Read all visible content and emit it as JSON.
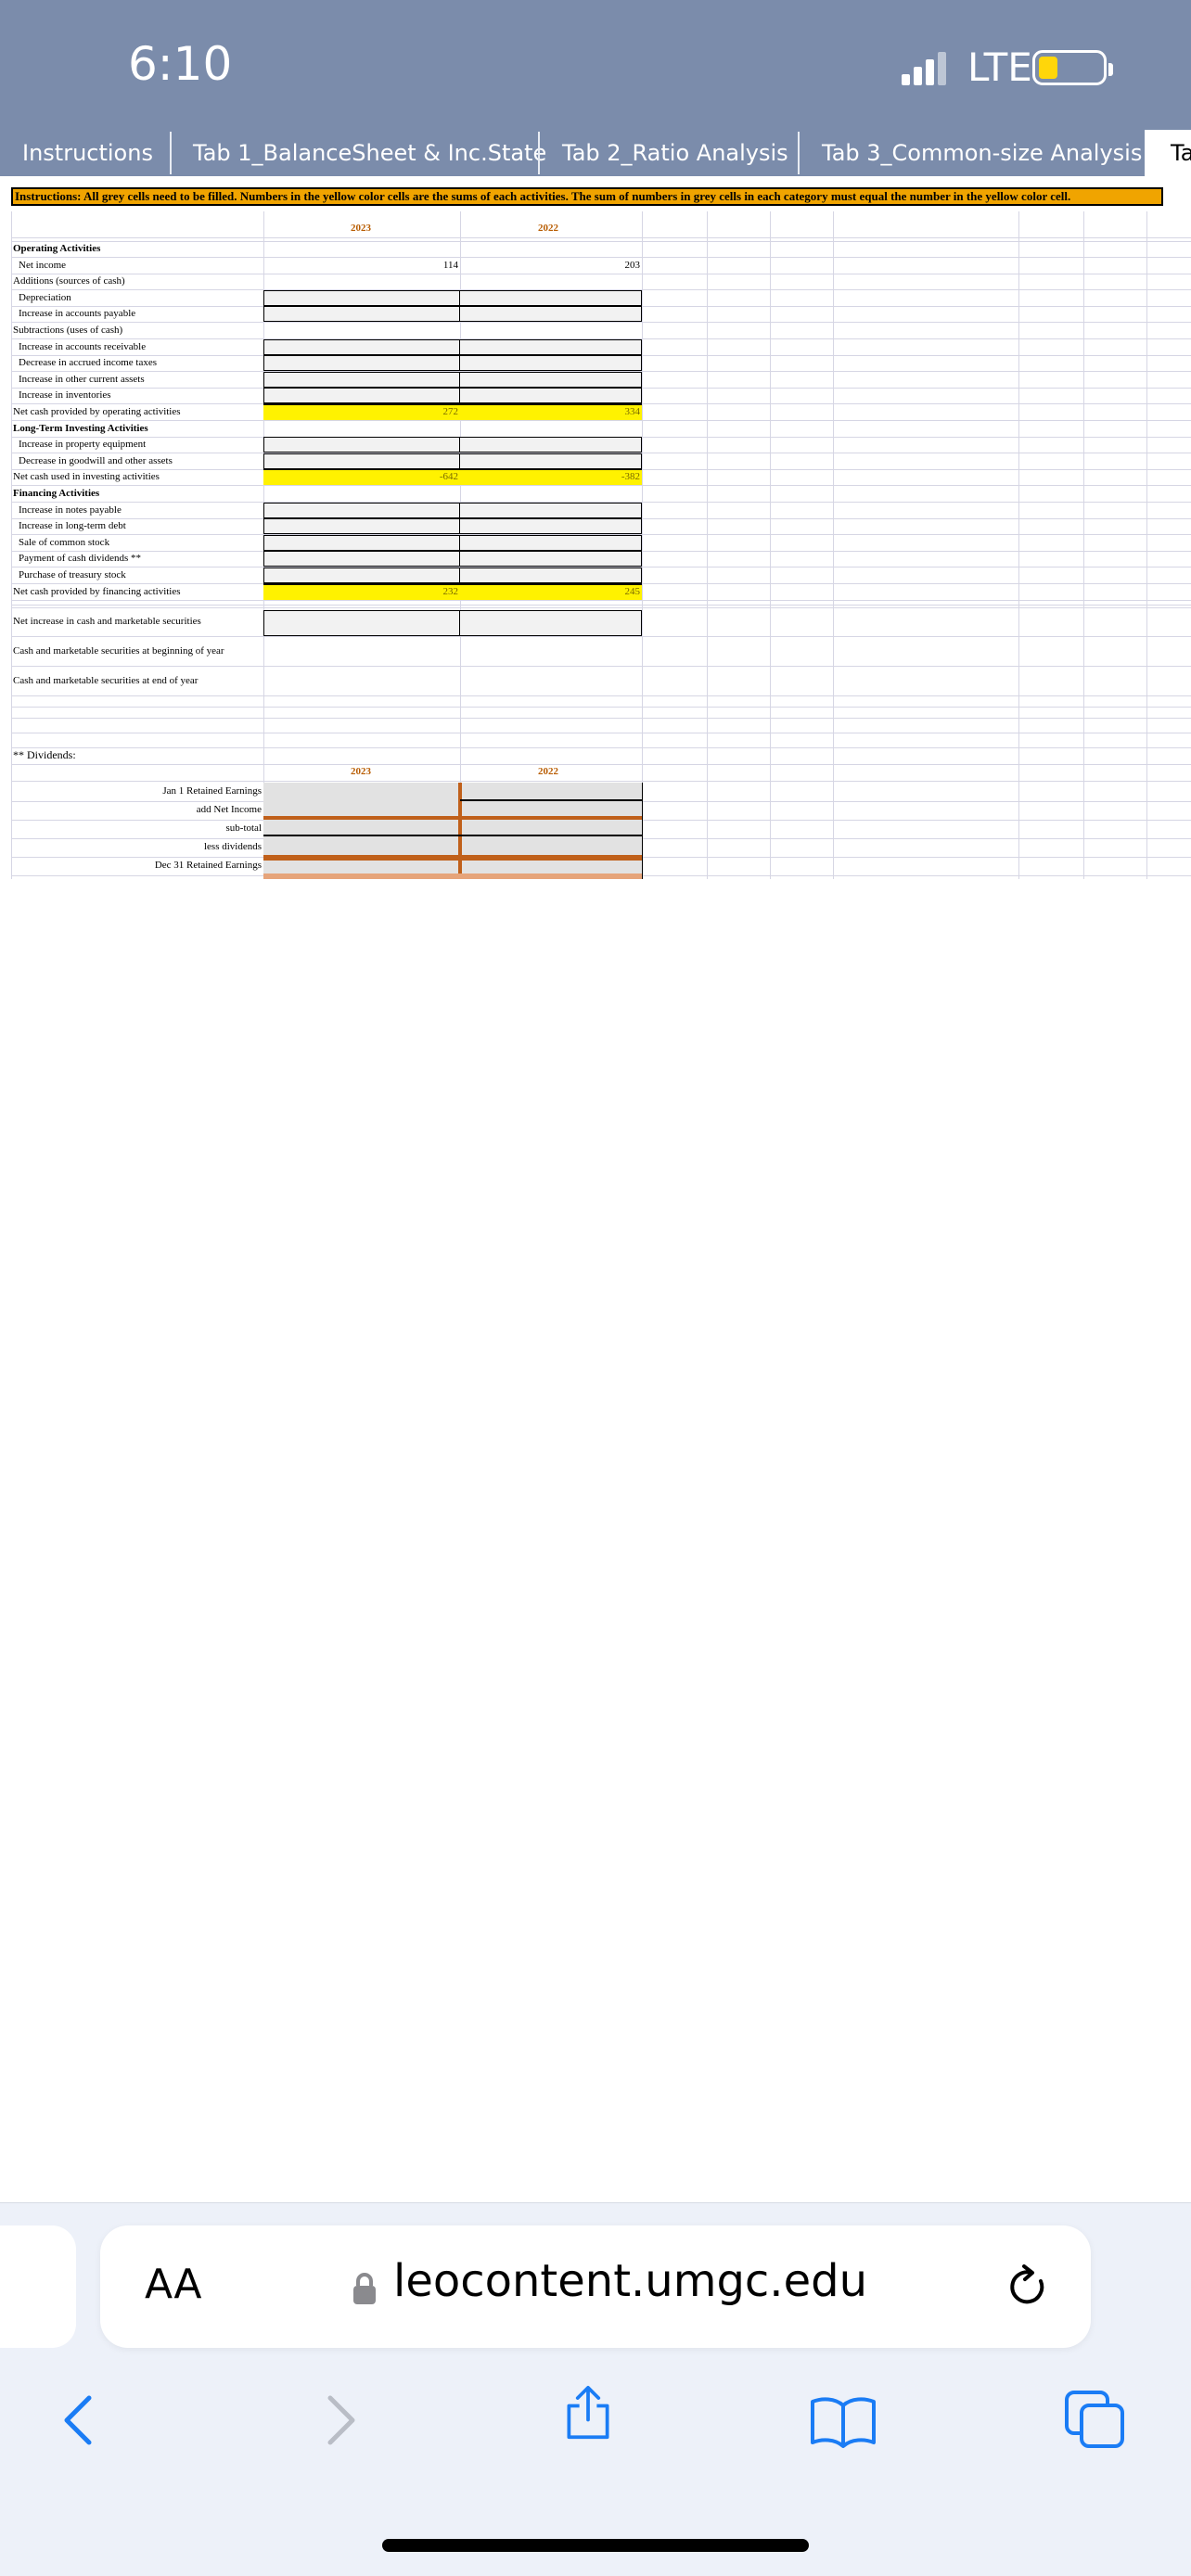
{
  "status_bar": {
    "time": "6:10",
    "network": "LTE"
  },
  "tabs": [
    {
      "label": "Instructions"
    },
    {
      "label": "Tab 1_BalanceSheet & Inc.State"
    },
    {
      "label": "Tab 2_Ratio Analysis"
    },
    {
      "label": "Tab 3_Common-size Analysis"
    },
    {
      "label": "Ta"
    }
  ],
  "sheet": {
    "instructions": "Instructions: All grey cells need to be filled. Numbers in the yellow color cells are the sums of each activities. The sum of numbers in grey cells in each category must equal the number in the yellow color cell.",
    "years": [
      "2023",
      "2022"
    ],
    "rows": [
      {
        "label": "Operating Activities",
        "style": "bold"
      },
      {
        "label": "Net income",
        "style": "ind",
        "v2023": "114",
        "v2022": "203"
      },
      {
        "label": "Additions (sources of cash)"
      },
      {
        "label": "Depreciation",
        "style": "ind"
      },
      {
        "label": "Increase in accounts payable",
        "style": "ind"
      },
      {
        "label": "Subtractions (uses of cash)"
      },
      {
        "label": "Increase in accounts receivable",
        "style": "ind"
      },
      {
        "label": "Decrease in accrued income taxes",
        "style": "ind"
      },
      {
        "label": "Increase in other current assets",
        "style": "ind"
      },
      {
        "label": "Increase in inventories",
        "style": "ind"
      },
      {
        "label": "Net cash provided by operating activities",
        "v2023": "272",
        "v2022": "334"
      },
      {
        "label": "Long-Term Investing Activities",
        "style": "bold"
      },
      {
        "label": "Increase in property equipment",
        "style": "ind"
      },
      {
        "label": "Decrease in goodwill and other assets",
        "style": "ind"
      },
      {
        "label": "Net cash used in investing activities",
        "v2023": "-642",
        "v2022": "-382"
      },
      {
        "label": "Financing Activities",
        "style": "bold"
      },
      {
        "label": "Increase in notes payable",
        "style": "ind"
      },
      {
        "label": "Increase in long-term debt",
        "style": "ind"
      },
      {
        "label": "Sale of common stock",
        "style": "ind"
      },
      {
        "label": "Payment of cash dividends **",
        "style": "ind"
      },
      {
        "label": "Purchase of treasury stock",
        "style": "ind"
      },
      {
        "label": "Net cash provided by financing activities",
        "v2023": "232",
        "v2022": "245"
      }
    ],
    "net_increase": "Net increase in cash and marketable securities",
    "cash_begin": "Cash and marketable securities at beginning of year",
    "cash_end": "Cash and marketable securities at end of year",
    "dividends_title": "** Dividends:",
    "dividend_rows": [
      "Jan 1 Retained Earnings",
      "add Net Income",
      "sub-total",
      "less dividends",
      "Dec 31 Retained Earnings"
    ]
  },
  "safari": {
    "aa": "AA",
    "url": "leocontent.umgc.edu"
  },
  "colors": {
    "status_bg": "#7b8cab",
    "yellow_cell": "#fff200",
    "instruction_bg": "#f0a400",
    "year_label": "#b85c00"
  }
}
